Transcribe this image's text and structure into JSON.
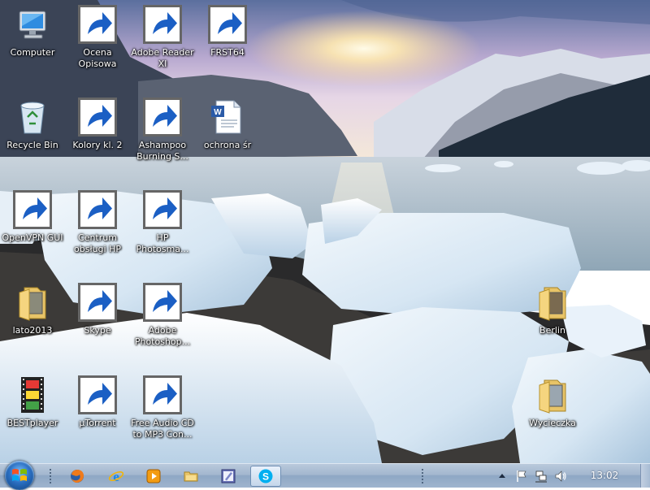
{
  "desktop": {
    "icons": [
      {
        "label": "Computer",
        "icon": "computer-icon",
        "shortcut": false
      },
      {
        "label": "Ocena Opisowa",
        "icon": "pen-document-icon",
        "shortcut": true
      },
      {
        "label": "Adobe Reader XI",
        "icon": "adobe-reader-icon",
        "shortcut": true
      },
      {
        "label": "FRST64",
        "icon": "frst-icon",
        "shortcut": true
      },
      {
        "label": "Recycle Bin",
        "icon": "recycle-bin-icon",
        "shortcut": false
      },
      {
        "label": "Kolory kl. 2",
        "icon": "kolory-icon",
        "shortcut": true
      },
      {
        "label": "Ashampoo Burning S...",
        "icon": "ashampoo-icon",
        "shortcut": true
      },
      {
        "label": "ochrona śr",
        "icon": "word-document-icon",
        "shortcut": false
      },
      {
        "label": "OpenVPN GUI",
        "icon": "openvpn-icon",
        "shortcut": true
      },
      {
        "label": "Centrum obsługi HP",
        "icon": "hp-icon",
        "shortcut": true
      },
      {
        "label": "HP Photosma...",
        "icon": "hp-photosmart-icon",
        "shortcut": true
      },
      {
        "label": "lato2013",
        "icon": "folder-icon",
        "shortcut": false
      },
      {
        "label": "Skype",
        "icon": "skype-icon",
        "shortcut": true
      },
      {
        "label": "Adobe Photoshop...",
        "icon": "photoshop-icon",
        "shortcut": true
      },
      {
        "label": "Berlin",
        "icon": "folder-icon",
        "shortcut": false
      },
      {
        "label": "BESTplayer",
        "icon": "film-strip-icon",
        "shortcut": false
      },
      {
        "label": "µTorrent",
        "icon": "utorrent-icon",
        "shortcut": true
      },
      {
        "label": "Free Audio CD to MP3 Con...",
        "icon": "mp3-converter-icon",
        "shortcut": true
      },
      {
        "label": "Wycieczka",
        "icon": "folder-icon",
        "shortcut": false
      }
    ]
  },
  "taskbar": {
    "start_icon": "windows-logo-icon",
    "pinned": [
      {
        "icon": "firefox-icon"
      },
      {
        "icon": "internet-explorer-icon"
      },
      {
        "icon": "media-player-icon"
      },
      {
        "icon": "explorer-folder-icon"
      },
      {
        "icon": "pen-document-icon"
      },
      {
        "icon": "skype-icon",
        "active": true
      }
    ],
    "tray": [
      "show-hidden-icons-icon",
      "action-center-flag-icon",
      "network-icon",
      "volume-icon"
    ],
    "clock": "13:02"
  },
  "colors": {
    "taskbar": "#a3b7cf",
    "label_text": "#ffffff",
    "skype": "#00aff0"
  }
}
